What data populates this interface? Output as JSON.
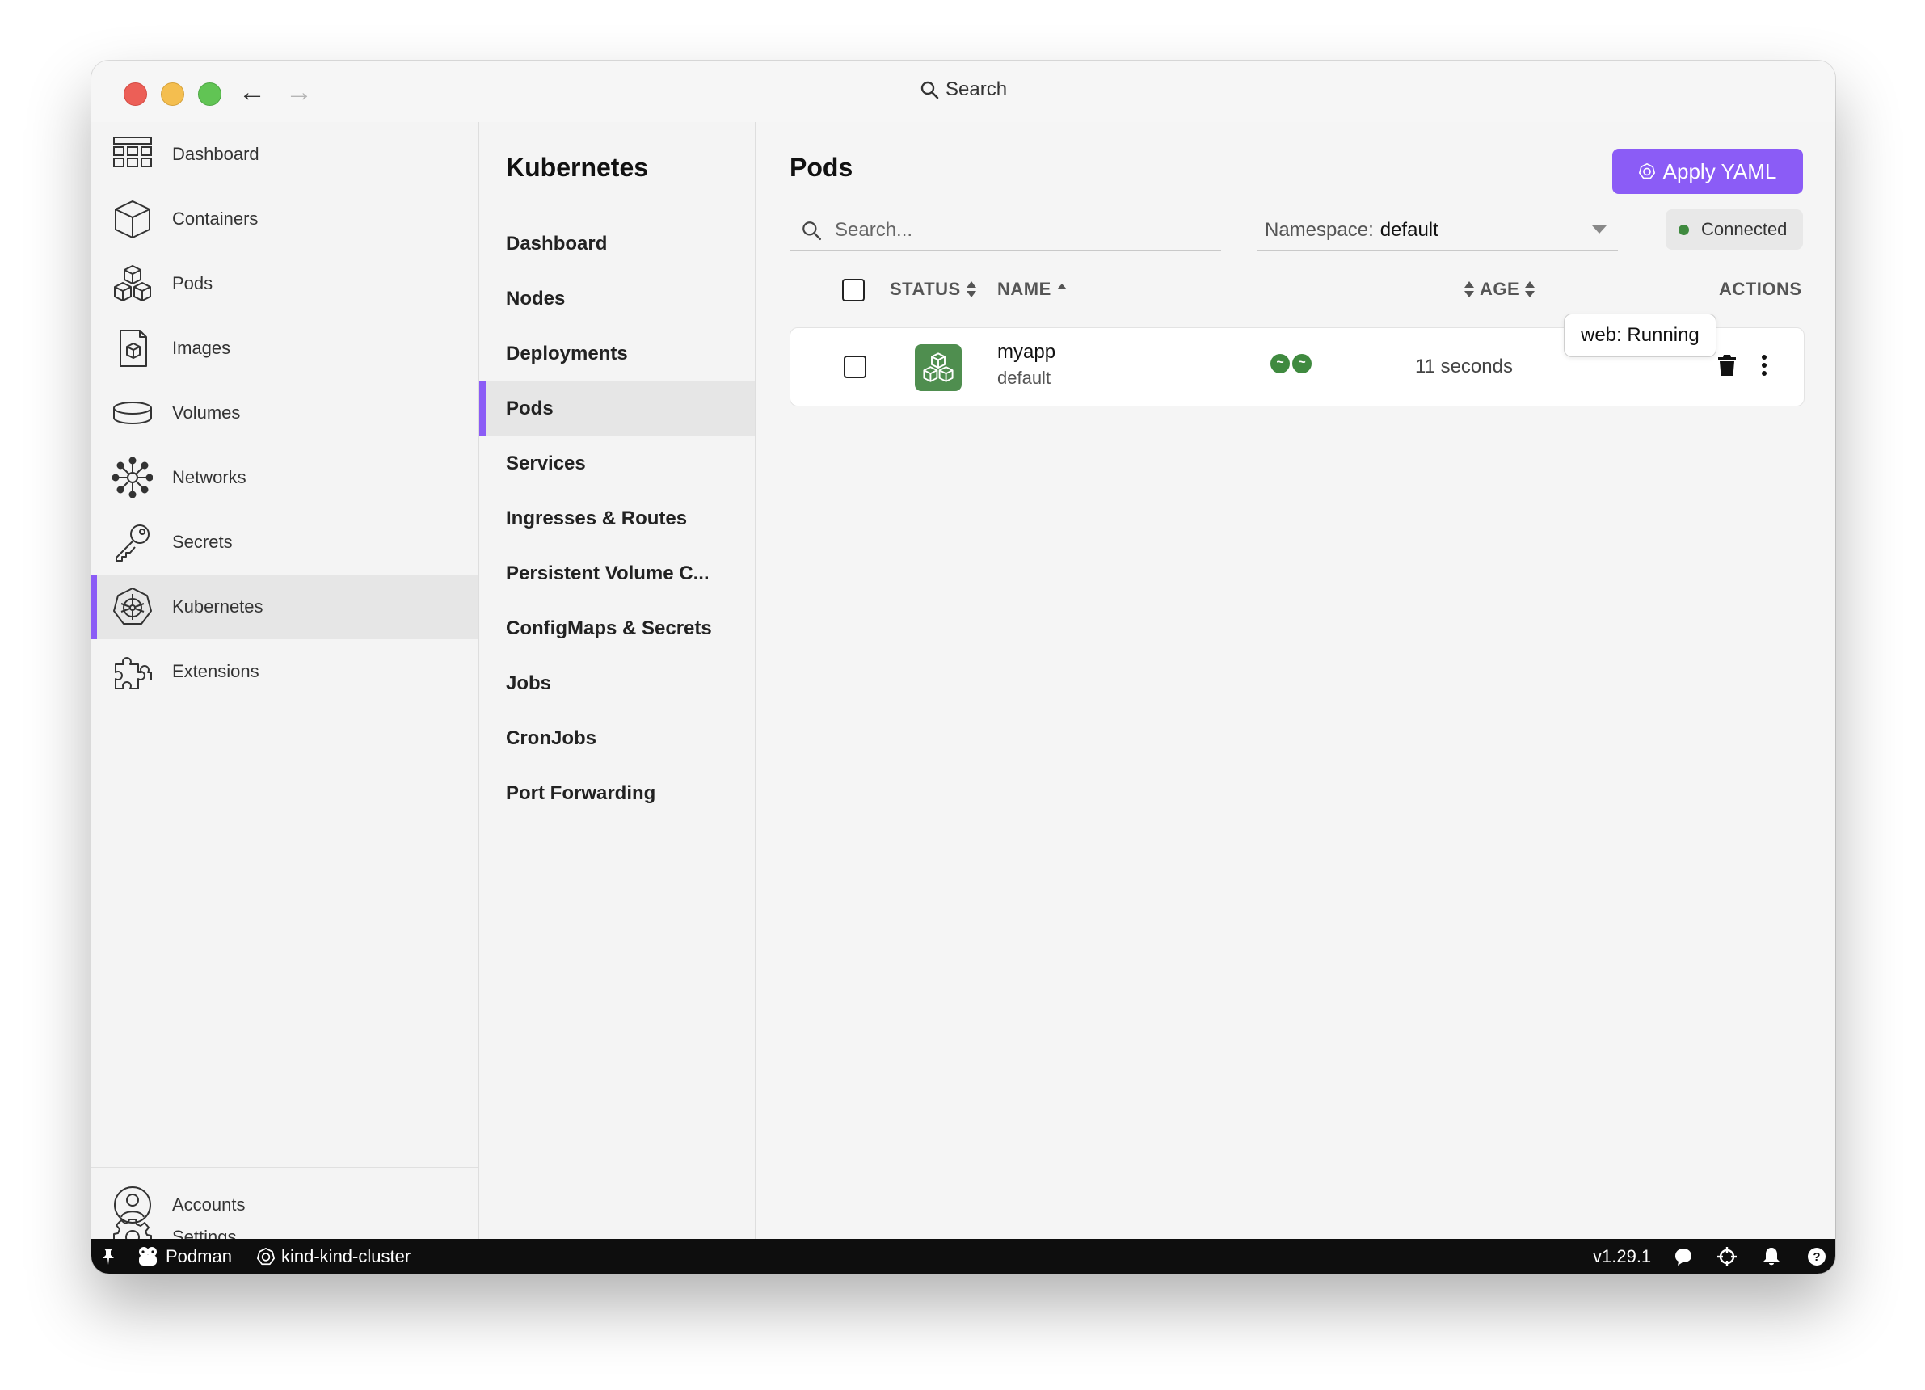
{
  "titlebar": {
    "search_label": "Search"
  },
  "leftnav": {
    "items": [
      {
        "label": "Dashboard",
        "icon": "dashboard-icon"
      },
      {
        "label": "Containers",
        "icon": "container-cube-icon"
      },
      {
        "label": "Pods",
        "icon": "pods-cubes-icon"
      },
      {
        "label": "Images",
        "icon": "image-file-icon"
      },
      {
        "label": "Volumes",
        "icon": "volume-icon"
      },
      {
        "label": "Networks",
        "icon": "network-icon"
      },
      {
        "label": "Secrets",
        "icon": "key-icon"
      },
      {
        "label": "Kubernetes",
        "icon": "kubernetes-helm-icon",
        "active": true
      },
      {
        "label": "Extensions",
        "icon": "puzzle-icon"
      }
    ],
    "bottom": [
      {
        "label": "Accounts",
        "icon": "account-icon"
      },
      {
        "label": "Settings",
        "icon": "gear-icon"
      }
    ]
  },
  "submenu": {
    "title": "Kubernetes",
    "items": [
      {
        "label": "Dashboard"
      },
      {
        "label": "Nodes"
      },
      {
        "label": "Deployments"
      },
      {
        "label": "Pods",
        "active": true
      },
      {
        "label": "Services"
      },
      {
        "label": "Ingresses & Routes"
      },
      {
        "label": "Persistent Volume C..."
      },
      {
        "label": "ConfigMaps & Secrets"
      },
      {
        "label": "Jobs"
      },
      {
        "label": "CronJobs"
      },
      {
        "label": "Port Forwarding"
      }
    ]
  },
  "main": {
    "title": "Pods",
    "apply_button": "Apply YAML",
    "search_placeholder": "Search...",
    "namespace_label": "Namespace:",
    "namespace_value": "default",
    "connection_status": "Connected",
    "columns": {
      "status": "STATUS",
      "name": "NAME",
      "age": "AGE",
      "actions": "ACTIONS"
    },
    "rows": [
      {
        "name": "myapp",
        "namespace": "default",
        "age": "11 seconds",
        "containers": [
          "running",
          "running"
        ]
      }
    ],
    "tooltip": "web: Running"
  },
  "statusbar": {
    "engine": "Podman",
    "context": "kind-kind-cluster",
    "version": "v1.29.1"
  },
  "colors": {
    "accent": "#8b5cf6",
    "running_green": "#3f8a3f",
    "pod_icon_bg": "#4f8e4f",
    "statusbar_bg": "#0e0e0e"
  }
}
